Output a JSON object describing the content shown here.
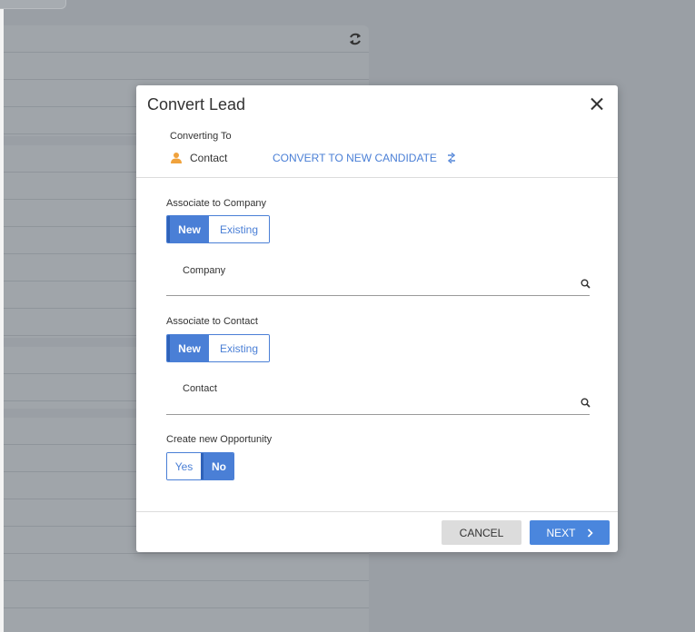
{
  "modal": {
    "title": "Convert Lead",
    "converting_to_label": "Converting To",
    "target_label": "Contact",
    "convert_link": "CONVERT TO NEW CANDIDATE",
    "company_section": {
      "label": "Associate to Company",
      "options": [
        "New",
        "Existing"
      ],
      "selected": "New",
      "field_label": "Company"
    },
    "contact_section": {
      "label": "Associate to Contact",
      "options": [
        "New",
        "Existing"
      ],
      "selected": "New",
      "field_label": "Contact"
    },
    "opportunity_section": {
      "label": "Create new Opportunity",
      "options": [
        "Yes",
        "No"
      ],
      "selected": "No"
    },
    "cancel_label": "CANCEL",
    "next_label": "NEXT"
  },
  "colors": {
    "accent": "#4a7fd6",
    "contact_icon": "#f0a23c"
  },
  "icons": {
    "close": "close-icon",
    "refresh": "refresh-icon",
    "contact": "person-icon",
    "swap": "swap-icon",
    "search": "search-icon",
    "next": "chevron-right-icon"
  }
}
